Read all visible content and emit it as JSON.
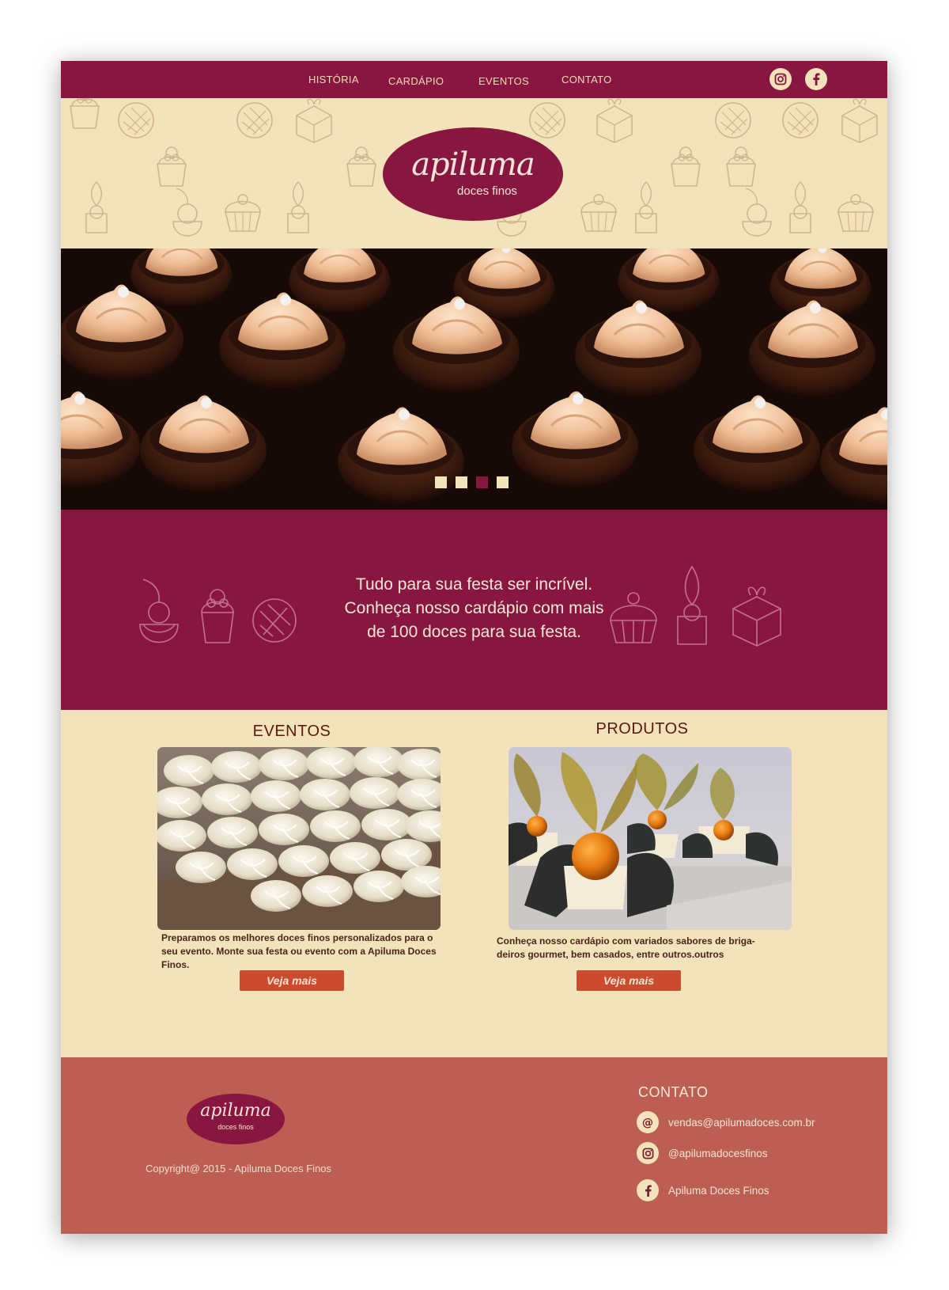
{
  "nav": {
    "items": [
      {
        "label": "HISTÓRIA"
      },
      {
        "label": "CARDÁPIO"
      },
      {
        "label": "EVENTOS"
      },
      {
        "label": "CONTATO"
      }
    ],
    "social": [
      "instagram-icon",
      "facebook-icon"
    ]
  },
  "brand": {
    "name": "apiluma",
    "subtitle": "doces finos"
  },
  "hero": {
    "slides_total": 4,
    "active_slide": 3
  },
  "tagline": {
    "lines": [
      "Tudo para sua festa ser incrível.",
      "Conheça nosso cardápio com mais",
      "de 100 doces para sua festa."
    ]
  },
  "sections": {
    "eventos": {
      "title": "EVENTOS",
      "text": "Preparamos os melhores doces finos personalizados para o seu evento.  Monte sua festa ou evento com a Apiluma Doces Finos.",
      "button": "Veja mais"
    },
    "produtos": {
      "title": "PRODUTOS",
      "text": "Conheça nosso cardápio com variados sabores de briga-deiros gourmet, bem casados, entre outros.outros",
      "button": "Veja mais"
    }
  },
  "footer": {
    "copyright": "Copyright@ 2015 - Apiluma Doces Finos",
    "contact_title": "CONTATO",
    "contacts": [
      {
        "icon": "at-icon",
        "text": "vendas@apilumadoces.com.br"
      },
      {
        "icon": "instagram-icon",
        "text": "@apilumadocesfinos"
      },
      {
        "icon": "facebook-icon",
        "text": "Apiluma Doces Finos"
      }
    ]
  },
  "colors": {
    "wine": "#891640",
    "cream": "#f3e3bb",
    "terracotta": "#bc5f52",
    "button": "#cc4a2d"
  }
}
